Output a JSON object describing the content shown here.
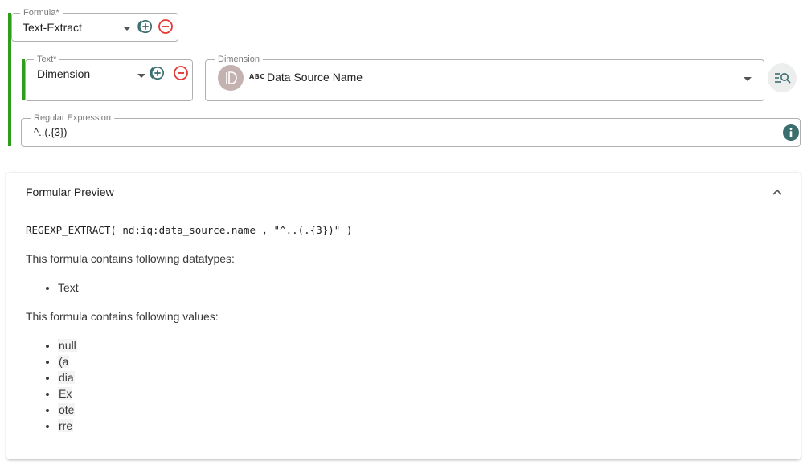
{
  "formula": {
    "legend": "Formula*",
    "value": "Text-Extract"
  },
  "text_arg": {
    "legend": "Text*",
    "value": "Dimension"
  },
  "dimension": {
    "legend": "Dimension",
    "type_badge": "ABC",
    "value": "Data Source Name"
  },
  "regex": {
    "legend": "Regular Expression",
    "value": "^..(.{3})"
  },
  "preview": {
    "title": "Formular Preview",
    "code": "REGEXP_EXTRACT( nd:iq:data_source.name , \"^..(.{3})\" )",
    "datatypes_text": "This formula contains following datatypes:",
    "datatypes": [
      "Text"
    ],
    "values_text": "This formula contains following values:",
    "values": [
      "null",
      " (a",
      "dia",
      " Ex",
      "ote",
      "rre"
    ]
  },
  "colors": {
    "accent_green": "#2e9e1a",
    "add_icon": "#3b6e6e",
    "remove_icon": "#e53935"
  },
  "icons": {
    "add": "add-circle-icon",
    "remove": "remove-circle-icon",
    "info": "info-icon",
    "dimension_avatar": "dimension-avatar-icon",
    "browse": "browse-dimensions-icon",
    "collapse": "chevron-up-icon",
    "dropdown": "caret-down-icon"
  }
}
